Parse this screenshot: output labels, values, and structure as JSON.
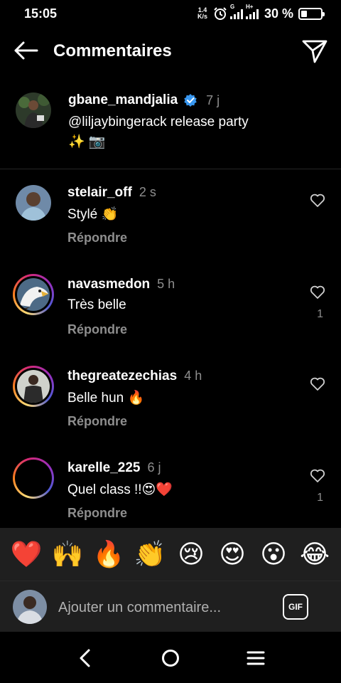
{
  "status": {
    "time": "15:05",
    "net_speed_value": "1.4",
    "net_speed_unit": "K/s",
    "signal1_tag": "G",
    "signal2_tag": "H+",
    "battery": "30 %"
  },
  "header": {
    "title": "Commentaires",
    "back_icon": "arrow-left-icon",
    "send_icon": "paper-plane-icon"
  },
  "caption": {
    "username": "gbane_mandjalia",
    "verified": true,
    "time": "7 j",
    "text_line1": "@liljaybingerack release party",
    "text_line2": "✨ 📷"
  },
  "comments": [
    {
      "username": "stelair_off",
      "time": "2 s",
      "text": "Stylé 👏",
      "reply": "Répondre",
      "likes": ""
    },
    {
      "username": "navasmedon",
      "time": "5 h",
      "text": "Très belle",
      "reply": "Répondre",
      "likes": "1"
    },
    {
      "username": "thegreatezechias",
      "time": "4 h",
      "text": "Belle hun 🔥",
      "reply": "Répondre",
      "likes": ""
    },
    {
      "username": "karelle_225",
      "time": "6 j",
      "text": "Quel class !!😍❤️",
      "reply": "Répondre",
      "likes": "1"
    }
  ],
  "emoji_bar": [
    "❤️",
    "🙌",
    "🔥",
    "👏",
    "😢",
    "😍",
    "😮",
    "😂"
  ],
  "input": {
    "placeholder": "Ajouter un commentaire...",
    "value": "",
    "gif_label": "GIF"
  },
  "colors": {
    "background": "#000000",
    "muted_text": "#8e8e8e",
    "verified_blue": "#3897f0",
    "panel": "#1f1f1f"
  }
}
